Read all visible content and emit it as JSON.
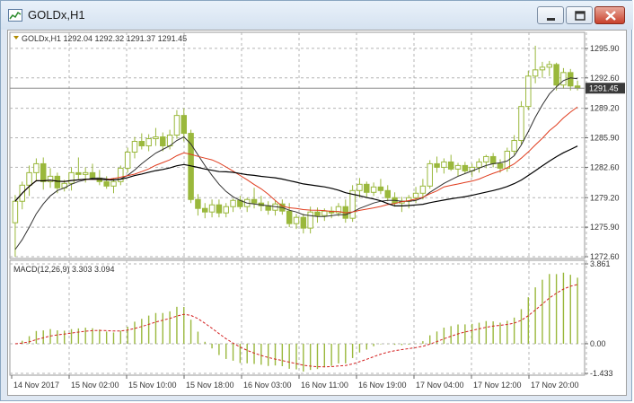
{
  "window": {
    "title": "GOLDx,H1",
    "minimize_icon": "minimize-icon",
    "maximize_icon": "maximize-icon",
    "close_icon": "close-icon"
  },
  "colors": {
    "bull": "#9ab83c",
    "bear": "#9ab83c",
    "fast_ma": "#303030",
    "mid_ma": "#e03c1e",
    "slow_ma": "#000000",
    "macd_hist": "#9ab83c",
    "macd_signal": "#d42020",
    "axis_text": "#333333",
    "grid": "#b4b4b4",
    "price_line": "#888888"
  },
  "price_header": "GOLDx,H1  1292.04 1292.32 1291.37 1291.45",
  "current_price": "1291.45",
  "macd_label": "MACD(12,26,9) 3.303 3.094",
  "chart_data": [
    {
      "type": "candlestick",
      "ylim": [
        1272.6,
        1297.5
      ],
      "y_ticks": [
        "1295.90",
        "1292.60",
        "1289.20",
        "1285.90",
        "1282.60",
        "1279.20",
        "1275.90",
        "1272.60"
      ],
      "current_price": 1291.45,
      "candles": [
        [
          1276.4,
          1279.5,
          1272.6,
          1278.8
        ],
        [
          1278.8,
          1281.0,
          1277.9,
          1280.6
        ],
        [
          1280.6,
          1282.8,
          1279.4,
          1282.0
        ],
        [
          1282.0,
          1283.6,
          1281.0,
          1283.0
        ],
        [
          1283.0,
          1283.7,
          1280.1,
          1281.0
        ],
        [
          1281.0,
          1282.5,
          1280.3,
          1281.6
        ],
        [
          1281.6,
          1282.0,
          1279.7,
          1280.3
        ],
        [
          1280.3,
          1281.2,
          1279.9,
          1280.8
        ],
        [
          1280.8,
          1282.6,
          1280.0,
          1282.0
        ],
        [
          1282.0,
          1283.7,
          1281.3,
          1281.8
        ],
        [
          1281.8,
          1282.6,
          1280.9,
          1282.0
        ],
        [
          1282.0,
          1283.0,
          1281.2,
          1281.4
        ],
        [
          1281.4,
          1282.3,
          1280.6,
          1281.0
        ],
        [
          1281.0,
          1281.6,
          1280.2,
          1280.5
        ],
        [
          1280.5,
          1281.4,
          1279.7,
          1281.0
        ],
        [
          1281.0,
          1282.8,
          1280.6,
          1282.5
        ],
        [
          1282.5,
          1284.8,
          1282.0,
          1284.3
        ],
        [
          1284.3,
          1286.0,
          1283.6,
          1285.5
        ],
        [
          1285.5,
          1286.4,
          1284.6,
          1285.0
        ],
        [
          1285.0,
          1286.3,
          1284.4,
          1285.8
        ],
        [
          1285.8,
          1287.0,
          1285.0,
          1286.0
        ],
        [
          1286.0,
          1286.5,
          1284.4,
          1285.0
        ],
        [
          1285.0,
          1286.8,
          1284.6,
          1286.2
        ],
        [
          1286.2,
          1289.0,
          1285.8,
          1288.4
        ],
        [
          1288.4,
          1289.2,
          1285.5,
          1286.4
        ],
        [
          1286.4,
          1286.8,
          1278.6,
          1279.0
        ],
        [
          1279.0,
          1279.6,
          1277.2,
          1278.0
        ],
        [
          1278.0,
          1278.6,
          1276.9,
          1277.6
        ],
        [
          1277.6,
          1279.0,
          1277.0,
          1278.4
        ],
        [
          1278.4,
          1279.0,
          1277.0,
          1277.5
        ],
        [
          1277.5,
          1278.6,
          1277.0,
          1278.2
        ],
        [
          1278.2,
          1279.1,
          1277.6,
          1278.9
        ],
        [
          1278.9,
          1279.4,
          1277.9,
          1278.2
        ],
        [
          1278.2,
          1279.2,
          1277.6,
          1279.0
        ],
        [
          1279.0,
          1280.3,
          1278.0,
          1278.6
        ],
        [
          1278.6,
          1279.4,
          1277.7,
          1278.3
        ],
        [
          1278.3,
          1278.8,
          1277.3,
          1277.8
        ],
        [
          1277.8,
          1278.9,
          1277.2,
          1278.5
        ],
        [
          1278.5,
          1279.0,
          1277.3,
          1277.7
        ],
        [
          1277.7,
          1278.6,
          1275.9,
          1276.3
        ],
        [
          1276.3,
          1277.4,
          1275.7,
          1277.0
        ],
        [
          1277.0,
          1277.4,
          1275.2,
          1275.8
        ],
        [
          1275.8,
          1278.2,
          1275.2,
          1277.6
        ],
        [
          1277.6,
          1278.1,
          1276.4,
          1277.2
        ],
        [
          1277.2,
          1278.0,
          1276.6,
          1277.7
        ],
        [
          1277.7,
          1278.2,
          1276.9,
          1277.5
        ],
        [
          1277.5,
          1278.6,
          1277.1,
          1278.2
        ],
        [
          1278.2,
          1279.0,
          1276.4,
          1276.9
        ],
        [
          1276.9,
          1280.6,
          1276.5,
          1280.0
        ],
        [
          1280.0,
          1281.4,
          1279.2,
          1280.7
        ],
        [
          1280.7,
          1281.0,
          1279.3,
          1279.8
        ],
        [
          1279.8,
          1280.9,
          1279.4,
          1280.4
        ],
        [
          1280.4,
          1281.3,
          1279.6,
          1280.0
        ],
        [
          1280.0,
          1280.6,
          1278.8,
          1279.2
        ],
        [
          1279.2,
          1279.8,
          1278.2,
          1278.6
        ],
        [
          1278.6,
          1279.3,
          1277.6,
          1278.8
        ],
        [
          1278.8,
          1279.5,
          1278.0,
          1279.2
        ],
        [
          1279.2,
          1280.4,
          1278.6,
          1279.7
        ],
        [
          1279.7,
          1281.3,
          1279.0,
          1280.5
        ],
        [
          1280.5,
          1283.4,
          1280.2,
          1283.0
        ],
        [
          1283.0,
          1283.8,
          1282.0,
          1282.6
        ],
        [
          1282.6,
          1283.6,
          1281.9,
          1283.2
        ],
        [
          1283.2,
          1284.0,
          1282.2,
          1282.4
        ],
        [
          1282.4,
          1283.1,
          1281.6,
          1282.8
        ],
        [
          1282.8,
          1283.2,
          1281.9,
          1282.2
        ],
        [
          1282.2,
          1283.0,
          1281.5,
          1282.6
        ],
        [
          1282.6,
          1283.6,
          1282.0,
          1283.2
        ],
        [
          1283.2,
          1284.0,
          1282.5,
          1283.8
        ],
        [
          1283.8,
          1284.2,
          1282.6,
          1283.0
        ],
        [
          1283.0,
          1283.5,
          1282.0,
          1282.5
        ],
        [
          1282.5,
          1284.8,
          1282.1,
          1284.4
        ],
        [
          1284.4,
          1286.2,
          1284.0,
          1285.6
        ],
        [
          1285.6,
          1290.0,
          1285.1,
          1289.4
        ],
        [
          1289.4,
          1293.4,
          1289.0,
          1292.8
        ],
        [
          1292.8,
          1296.2,
          1292.0,
          1293.5
        ],
        [
          1293.5,
          1294.4,
          1292.6,
          1293.8
        ],
        [
          1293.8,
          1294.5,
          1292.8,
          1294.1
        ],
        [
          1294.1,
          1294.3,
          1291.2,
          1291.8
        ],
        [
          1291.8,
          1293.7,
          1291.4,
          1293.2
        ],
        [
          1293.2,
          1293.6,
          1291.2,
          1291.7
        ],
        [
          1291.7,
          1292.3,
          1291.2,
          1291.45
        ]
      ],
      "fast_ma": [
        1273.4,
        1274.5,
        1275.9,
        1277.4,
        1278.5,
        1279.4,
        1280.0,
        1280.3,
        1280.7,
        1281.0,
        1281.2,
        1281.4,
        1281.4,
        1281.3,
        1281.2,
        1281.3,
        1281.7,
        1282.3,
        1283.0,
        1283.6,
        1284.2,
        1284.6,
        1285.0,
        1285.6,
        1286.0,
        1285.2,
        1284.0,
        1282.8,
        1281.7,
        1280.7,
        1279.9,
        1279.3,
        1278.9,
        1278.6,
        1278.5,
        1278.4,
        1278.3,
        1278.2,
        1278.1,
        1277.8,
        1277.6,
        1277.3,
        1277.2,
        1277.1,
        1277.1,
        1277.2,
        1277.3,
        1277.3,
        1277.6,
        1278.0,
        1278.3,
        1278.6,
        1278.8,
        1278.9,
        1278.9,
        1278.8,
        1278.8,
        1278.9,
        1279.2,
        1279.8,
        1280.3,
        1280.8,
        1281.2,
        1281.6,
        1281.9,
        1282.2,
        1282.5,
        1282.8,
        1283.0,
        1283.1,
        1283.3,
        1283.9,
        1285.1,
        1286.6,
        1288.2,
        1289.6,
        1290.8,
        1291.6,
        1292.3,
        1292.6,
        1292.5
      ]
    },
    {
      "type": "bar",
      "name": "MACD",
      "ylim": [
        -1.433,
        3.861
      ],
      "y_ticks": [
        "3.861",
        "0.00",
        "-1.433"
      ],
      "x_ticks": [
        "14 Nov 2017",
        "15 Nov 02:00",
        "15 Nov 10:00",
        "15 Nov 18:00",
        "16 Nov 03:00",
        "16 Nov 11:00",
        "16 Nov 19:00",
        "17 Nov 04:00",
        "17 Nov 12:00",
        "17 Nov 20:00"
      ]
    }
  ]
}
